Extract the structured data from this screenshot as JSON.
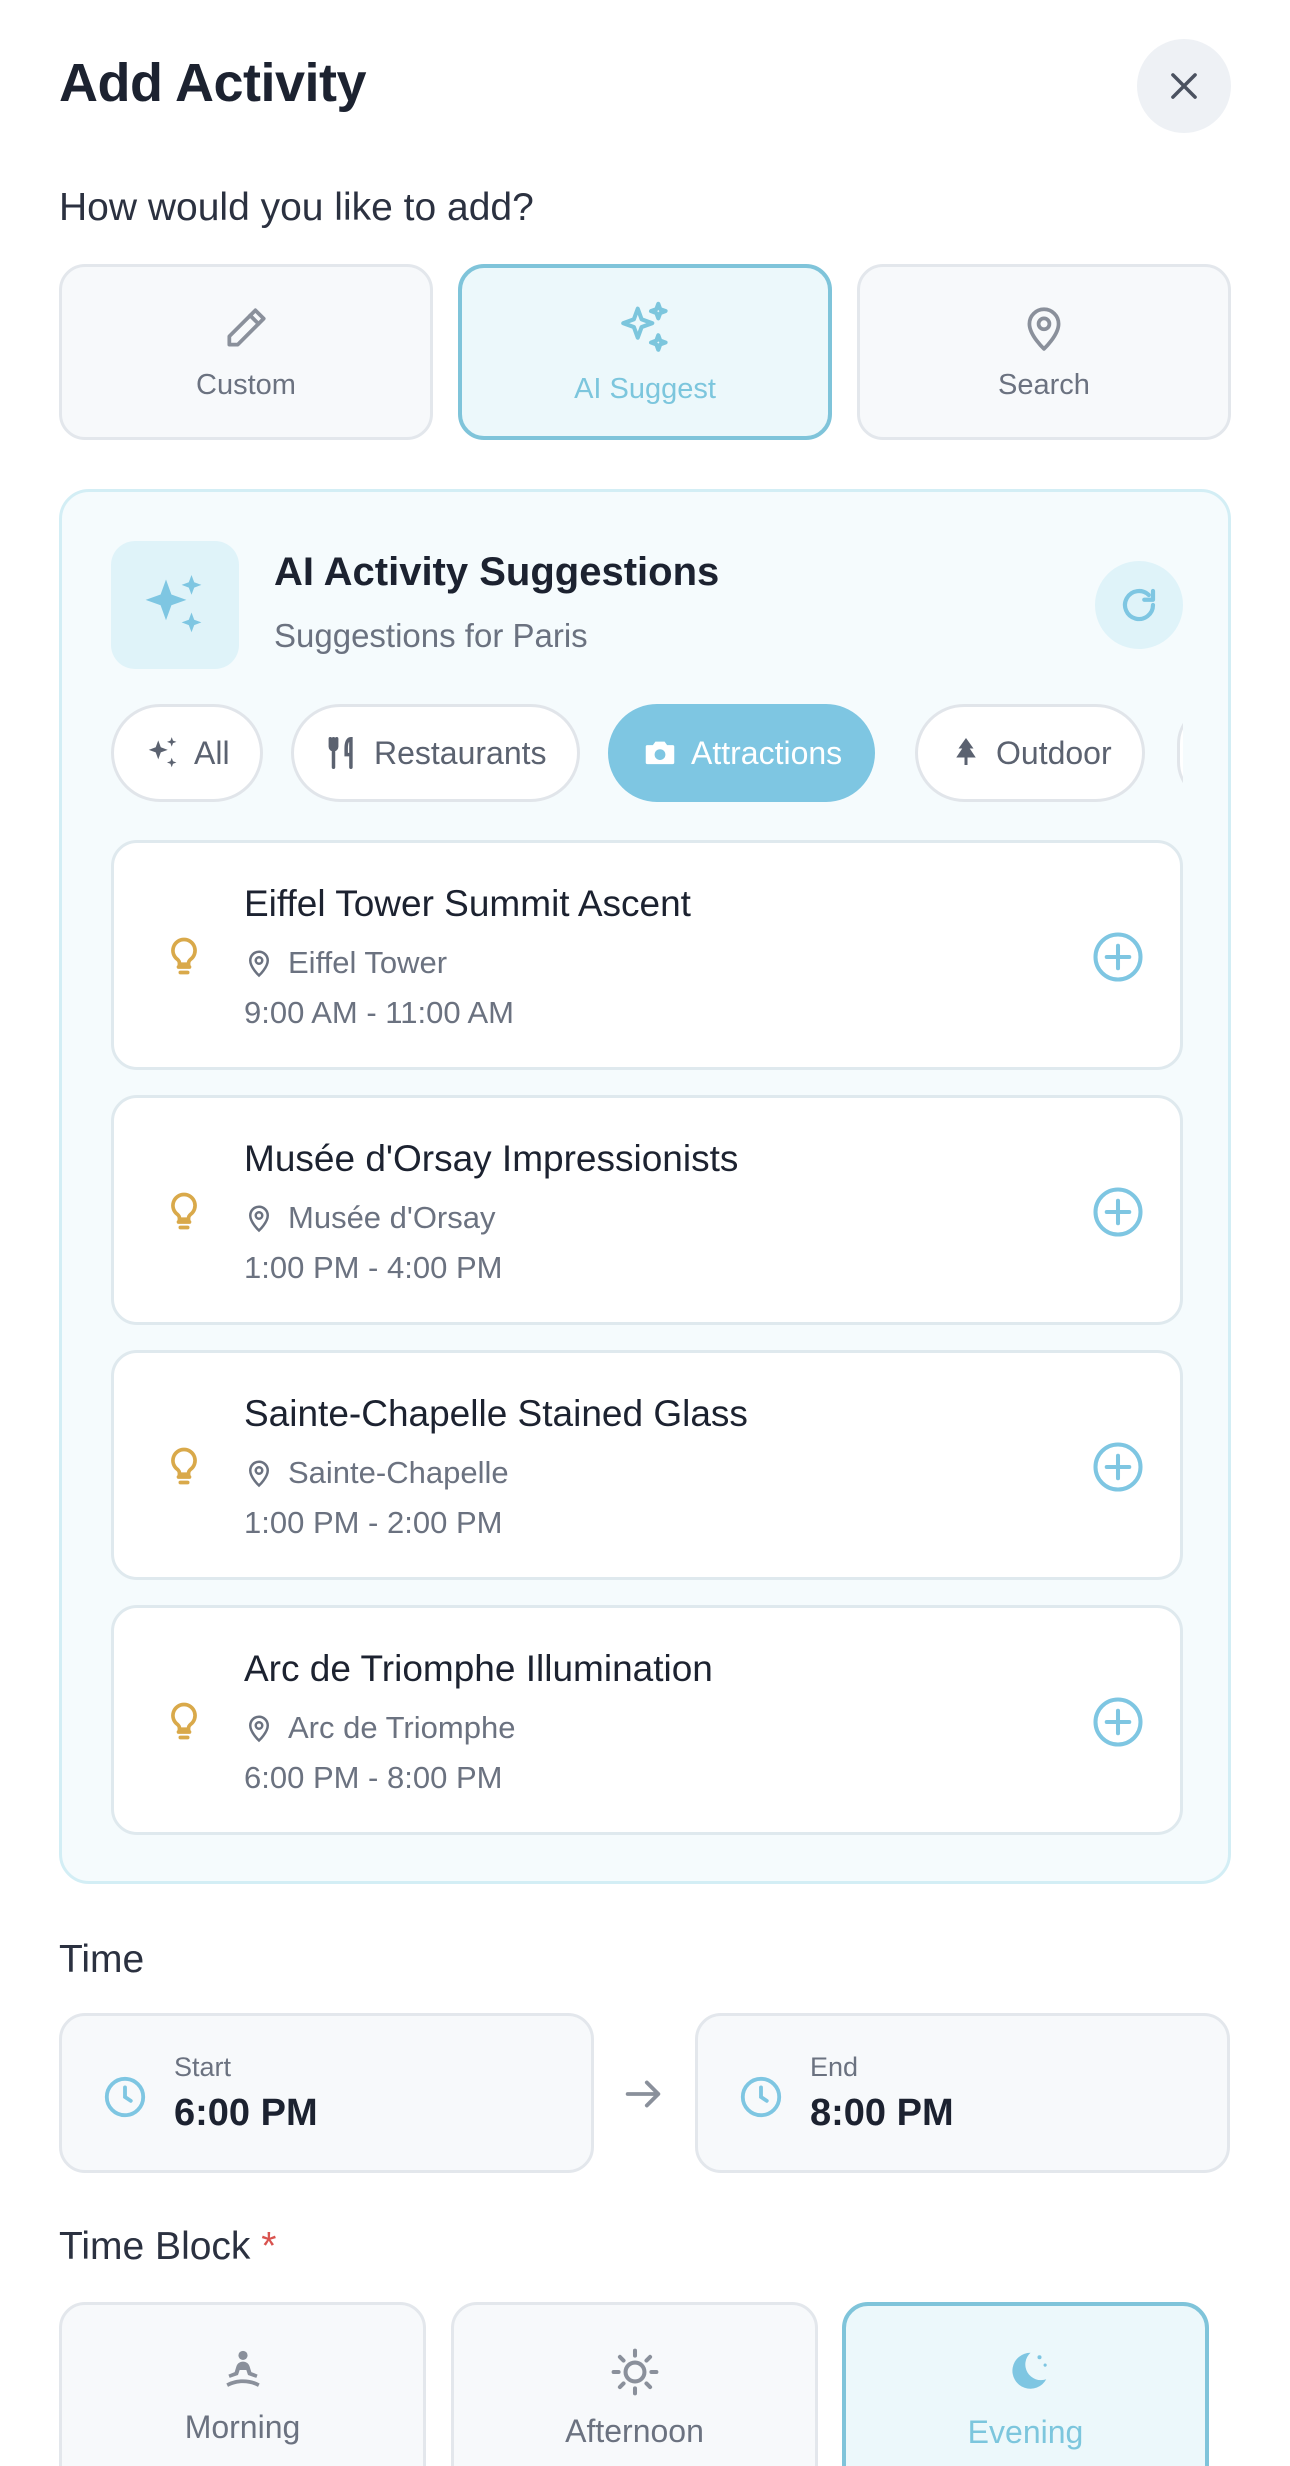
{
  "header": {
    "title": "Add Activity"
  },
  "add_mode": {
    "prompt": "How would you like to add?",
    "options": [
      {
        "label": "Custom",
        "icon": "pencil-icon",
        "selected": false
      },
      {
        "label": "AI Suggest",
        "icon": "sparkles-icon",
        "selected": true
      },
      {
        "label": "Search",
        "icon": "map-pin-icon",
        "selected": false
      }
    ]
  },
  "ai_panel": {
    "title": "AI Activity Suggestions",
    "subtitle": "Suggestions for Paris",
    "categories": [
      {
        "label": "All",
        "icon": "sparkles-icon",
        "selected": false
      },
      {
        "label": "Restaurants",
        "icon": "utensils-icon",
        "selected": false
      },
      {
        "label": "Attractions",
        "icon": "camera-icon",
        "selected": true
      },
      {
        "label": "Outdoor",
        "icon": "tree-icon",
        "selected": false
      }
    ],
    "suggestions": [
      {
        "name": "Eiffel Tower Summit Ascent",
        "location": "Eiffel Tower",
        "time": "9:00 AM - 11:00 AM"
      },
      {
        "name": "Musée d'Orsay Impressionists",
        "location": "Musée d'Orsay",
        "time": "1:00 PM - 4:00 PM"
      },
      {
        "name": "Sainte-Chapelle Stained Glass",
        "location": "Sainte-Chapelle",
        "time": "1:00 PM - 2:00 PM"
      },
      {
        "name": "Arc de Triomphe Illumination",
        "location": "Arc de Triomphe",
        "time": "6:00 PM - 8:00 PM"
      }
    ]
  },
  "time": {
    "label": "Time",
    "start_label": "Start",
    "start_value": "6:00 PM",
    "end_label": "End",
    "end_value": "8:00 PM"
  },
  "time_block": {
    "label": "Time Block",
    "required_mark": "*",
    "options": [
      {
        "label": "Morning",
        "icon": "meditation-icon",
        "selected": false
      },
      {
        "label": "Afternoon",
        "icon": "sun-icon",
        "selected": false
      },
      {
        "label": "Evening",
        "icon": "moon-icon",
        "selected": true
      }
    ]
  },
  "colors": {
    "accent": "#7ec6e2",
    "accent_light": "#ecf8fb",
    "bulb": "#d9a94a",
    "text": "#1c2230",
    "muted": "#6b7280"
  }
}
